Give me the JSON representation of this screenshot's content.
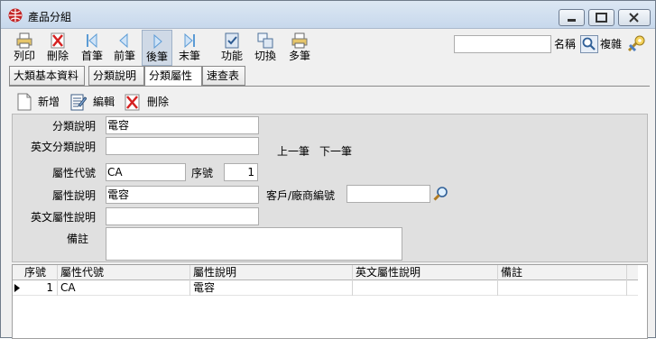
{
  "window": {
    "title": "產品分組"
  },
  "toolbar": {
    "print": "列印",
    "delete": "刪除",
    "first": "首筆",
    "prev": "前筆",
    "next": "後筆",
    "last": "末筆",
    "function": "功能",
    "switch": "切換",
    "multi": "多筆",
    "search_value": "",
    "name_label": "名稱",
    "complex_label": "複雜"
  },
  "tabs": [
    "大類基本資料",
    "分類說明",
    "分類屬性",
    "速查表"
  ],
  "active_tab": 2,
  "subtoolbar": {
    "add": "新增",
    "edit": "編輯",
    "delete": "刪除"
  },
  "form": {
    "category_desc_label": "分類說明",
    "category_desc_value": "電容",
    "english_category_desc_label": "英文分類說明",
    "english_category_desc_value": "",
    "nav_prev": "上一筆",
    "nav_next": "下一筆",
    "attr_code_label": "屬性代號",
    "attr_code_value": "CA",
    "seq_label": "序號",
    "seq_value": "1",
    "attr_desc_label": "屬性說明",
    "attr_desc_value": "電容",
    "customer_code_label": "客戶/廠商編號",
    "customer_code_value": "",
    "english_attr_desc_label": "英文屬性說明",
    "english_attr_desc_value": "",
    "remark_label": "備註",
    "remark_value": ""
  },
  "grid": {
    "columns": [
      "序號",
      "屬性代號",
      "屬性說明",
      "英文屬性說明",
      "備註"
    ],
    "rows": [
      [
        "1",
        "CA",
        "電容",
        "",
        ""
      ]
    ]
  }
}
